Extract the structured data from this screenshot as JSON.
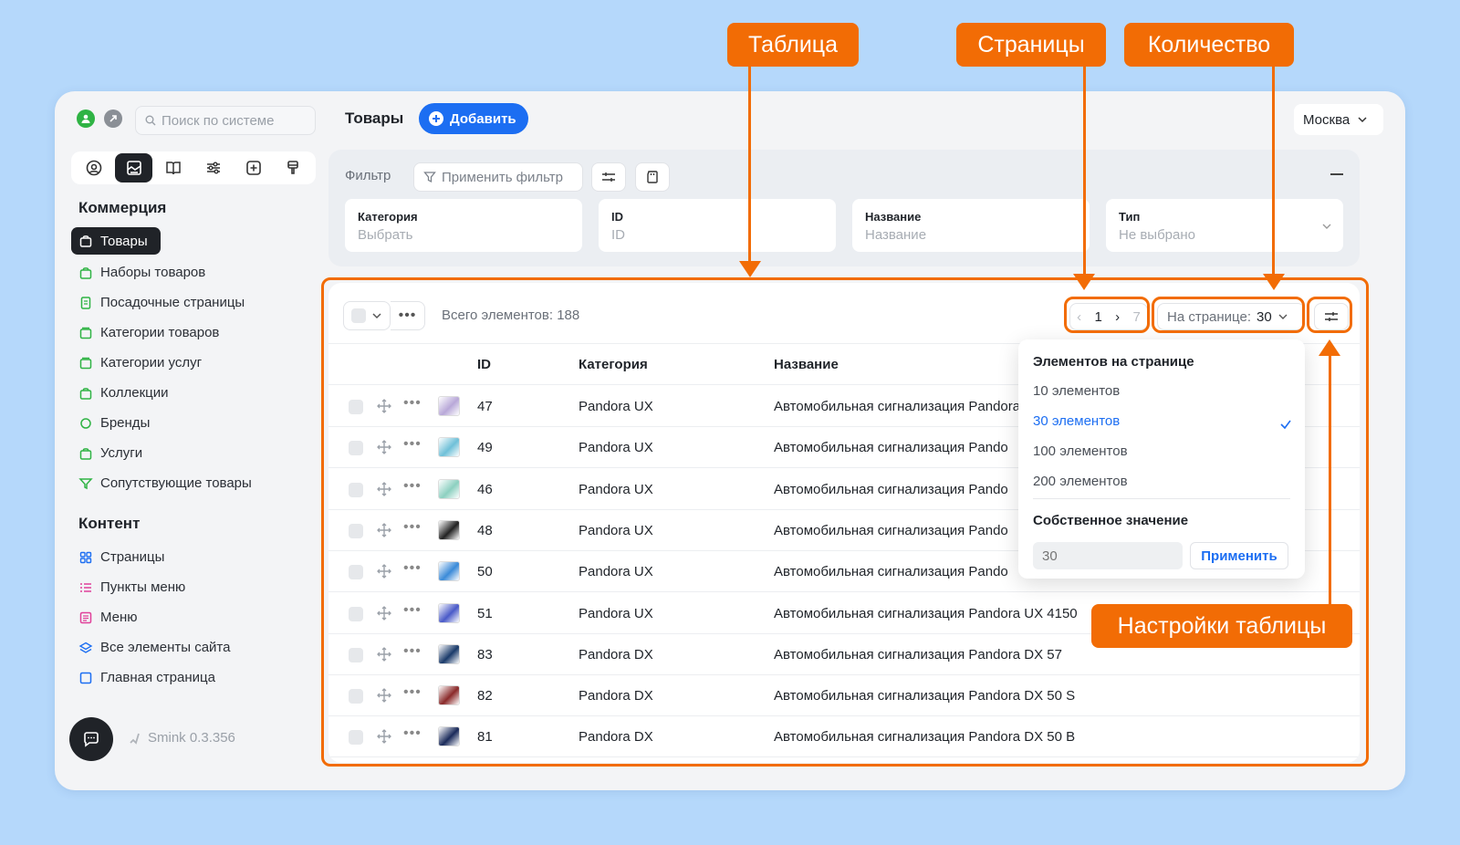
{
  "app": {
    "version": "Smink 0.3.356"
  },
  "search": {
    "placeholder": "Поиск по системе"
  },
  "header": {
    "title": "Товары",
    "add_label": "Добавить",
    "city": "Москва"
  },
  "sidebar": {
    "commerce_title": "Коммерция",
    "commerce_items": [
      {
        "label": "Товары",
        "icon": "bag-icon",
        "color": "#ffffff"
      },
      {
        "label": "Наборы товаров",
        "icon": "bag-icon",
        "color": "#2fb344"
      },
      {
        "label": "Посадочные страницы",
        "icon": "doc-icon",
        "color": "#2fb344"
      },
      {
        "label": "Категории товаров",
        "icon": "folder-icon",
        "color": "#2fb344"
      },
      {
        "label": "Категории услуг",
        "icon": "folder-icon",
        "color": "#2fb344"
      },
      {
        "label": "Коллекции",
        "icon": "bag-icon",
        "color": "#2fb344"
      },
      {
        "label": "Бренды",
        "icon": "badge-icon",
        "color": "#2fb344"
      },
      {
        "label": "Услуги",
        "icon": "bag-icon",
        "color": "#2fb344"
      },
      {
        "label": "Сопутствующие товары",
        "icon": "funnel-icon",
        "color": "#2fb344"
      }
    ],
    "content_title": "Контент",
    "content_items": [
      {
        "label": "Страницы",
        "icon": "grid-icon",
        "color": "#1c6ef2"
      },
      {
        "label": "Пункты меню",
        "icon": "list-icon",
        "color": "#e0409a"
      },
      {
        "label": "Меню",
        "icon": "menu-icon",
        "color": "#e0409a"
      },
      {
        "label": "Все элементы сайта",
        "icon": "layers-icon",
        "color": "#1c6ef2"
      },
      {
        "label": "Главная страница",
        "icon": "square-icon",
        "color": "#1c6ef2"
      }
    ]
  },
  "filter": {
    "label": "Фильтр",
    "apply_label": "Применить фильтр",
    "fields": [
      {
        "label": "Категория",
        "placeholder": "Выбрать"
      },
      {
        "label": "ID",
        "placeholder": "ID"
      },
      {
        "label": "Название",
        "placeholder": "Название"
      },
      {
        "label": "Тип",
        "placeholder": "Не выбрано"
      }
    ]
  },
  "table": {
    "total_label": "Всего элементов: 188",
    "pager": {
      "current": "1",
      "total": "7"
    },
    "per_page_label": "На странице:",
    "per_page_value": "30",
    "columns": [
      "ID",
      "Категория",
      "Название"
    ],
    "rows": [
      {
        "id": "47",
        "category": "Pandora UX",
        "name": "Автомобильная сигнализация Pandora",
        "thumb": "#b8a8d8"
      },
      {
        "id": "49",
        "category": "Pandora UX",
        "name": "Автомобильная сигнализация Pando",
        "thumb": "#6fc0d8"
      },
      {
        "id": "46",
        "category": "Pandora UX",
        "name": "Автомобильная сигнализация Pando",
        "thumb": "#8cd0c0"
      },
      {
        "id": "48",
        "category": "Pandora UX",
        "name": "Автомобильная сигнализация Pando",
        "thumb": "#222222"
      },
      {
        "id": "50",
        "category": "Pandora UX",
        "name": "Автомобильная сигнализация Pando",
        "thumb": "#3a8ad8"
      },
      {
        "id": "51",
        "category": "Pandora UX",
        "name": "Автомобильная сигнализация Pandora UX 4150",
        "thumb": "#4a5ac8"
      },
      {
        "id": "83",
        "category": "Pandora DX",
        "name": "Автомобильная сигнализация Pandora DX 57",
        "thumb": "#1a3a6a"
      },
      {
        "id": "82",
        "category": "Pandora DX",
        "name": "Автомобильная сигнализация Pandora DX 50 S",
        "thumb": "#8a2a2a"
      },
      {
        "id": "81",
        "category": "Pandora DX",
        "name": "Автомобильная сигнализация Pandora DX 50 B",
        "thumb": "#1a2a5a"
      }
    ]
  },
  "per_page_dropdown": {
    "title": "Элементов на странице",
    "options": [
      "10 элементов",
      "30 элементов",
      "100 элементов",
      "200 элементов"
    ],
    "selected": "30 элементов",
    "custom_title": "Собственное значение",
    "custom_placeholder": "30",
    "apply_label": "Применить"
  },
  "annotations": {
    "table": "Таблица",
    "pages": "Страницы",
    "count": "Количество",
    "settings": "Настройки таблицы",
    "color": "#f26c05"
  }
}
